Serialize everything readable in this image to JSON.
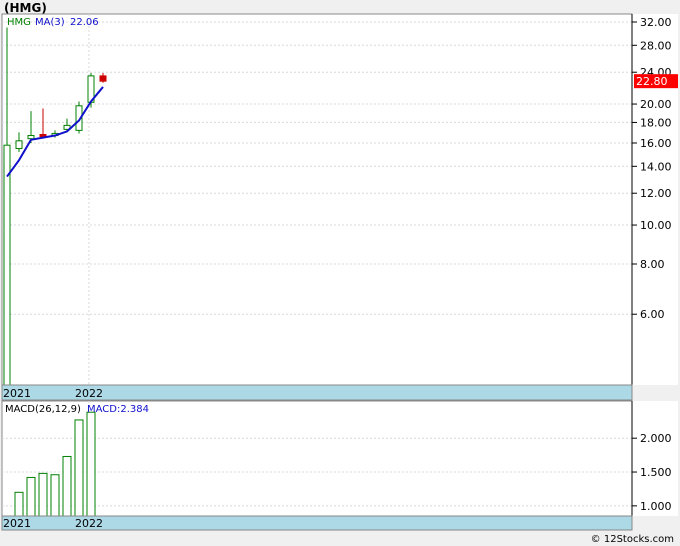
{
  "ticker_title": "(HMG)",
  "footer": "© 12Stocks.com",
  "chart_data": [
    {
      "type": "candlestick",
      "title": "(HMG)",
      "legend": {
        "symbol": "HMG",
        "ma_label": "MA(3)",
        "ma_value": "22.06"
      },
      "last_price_label": "22.80",
      "y_scale": "log",
      "ylim": [
        4.0,
        33.5
      ],
      "y_ticks": [
        "32.00",
        "28.00",
        "24.00",
        "20.00",
        "18.00",
        "16.00",
        "14.00",
        "12.00",
        "10.00",
        "8.00",
        "6.00"
      ],
      "x_labels": [
        "2021",
        "2022"
      ],
      "candles": [
        {
          "open": 4.0,
          "high": 31.0,
          "low": 4.0,
          "close": 15.8
        },
        {
          "open": 15.5,
          "high": 17.0,
          "low": 15.2,
          "close": 16.2
        },
        {
          "open": 16.4,
          "high": 19.2,
          "low": 16.0,
          "close": 16.7
        },
        {
          "open": 16.8,
          "high": 19.5,
          "low": 16.4,
          "close": 16.6
        },
        {
          "open": 16.7,
          "high": 17.2,
          "low": 16.5,
          "close": 16.9
        },
        {
          "open": 17.3,
          "high": 18.4,
          "low": 17.0,
          "close": 17.7
        },
        {
          "open": 17.2,
          "high": 20.3,
          "low": 16.9,
          "close": 19.8
        },
        {
          "open": 20.2,
          "high": 23.9,
          "low": 19.6,
          "close": 23.5
        },
        {
          "open": 23.5,
          "high": 23.9,
          "low": 22.6,
          "close": 22.8
        }
      ],
      "ma_values": [
        13.2,
        14.5,
        16.3,
        16.5,
        16.7,
        17.1,
        18.2,
        20.3,
        22.06
      ],
      "colors": {
        "up": "#008000",
        "down": "#cc0000",
        "ma": "#1010cc",
        "band": "#add8e6",
        "last_price_bg": "#ff0000"
      }
    },
    {
      "type": "bar",
      "legend": {
        "label": "MACD(26,12,9)",
        "value_label": "MACD:2.384"
      },
      "ylim": [
        0.85,
        2.55
      ],
      "y_ticks": [
        "2.000",
        "1.500",
        "1.000"
      ],
      "x_labels": [
        "2021",
        "2022"
      ],
      "values": [
        1.2,
        1.42,
        1.48,
        1.46,
        1.73,
        2.27,
        2.384
      ],
      "colors": {
        "bar": "#008000",
        "value": "#1010cc"
      }
    }
  ]
}
